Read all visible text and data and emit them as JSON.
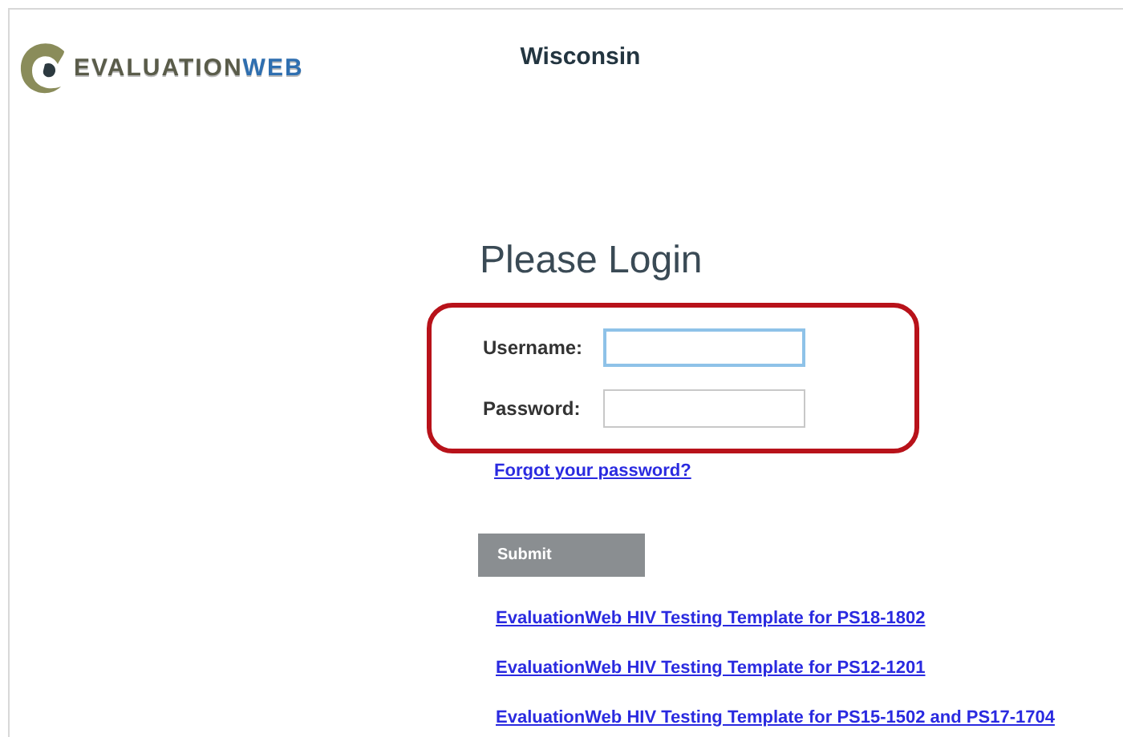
{
  "header": {
    "logo": [
      "EVALUATION",
      "WEB"
    ],
    "title": "Wisconsin"
  },
  "login": {
    "heading": "Please Login",
    "fields": [
      {
        "label": "Username:",
        "focused": true
      },
      {
        "label": "Password:",
        "focused": false
      }
    ],
    "highlighted": true,
    "forgot_link": "Forgot your password?",
    "submit": "Submit"
  },
  "links": [
    "EvaluationWeb HIV Testing Template for PS18-1802",
    "EvaluationWeb HIV Testing Template for PS12-1201",
    "EvaluationWeb HIV Testing Template for PS15-1502 and PS17-1704"
  ]
}
